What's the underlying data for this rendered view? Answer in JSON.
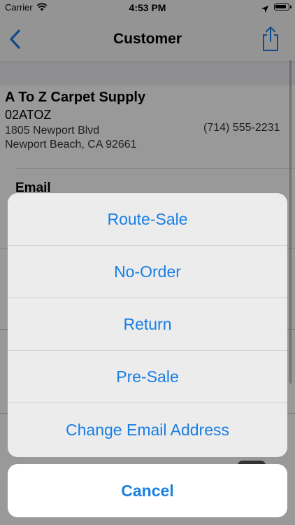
{
  "status_bar": {
    "carrier": "Carrier",
    "time": "4:53 PM"
  },
  "nav": {
    "title": "Customer"
  },
  "customer": {
    "name": "A To Z Carpet Supply",
    "code": "02ATOZ",
    "address_line1": "1805 Newport Blvd",
    "address_line2": "Newport Beach, CA  92661",
    "phone": "(714) 555-2231"
  },
  "section": {
    "email_label": "Email"
  },
  "action_sheet": {
    "actions": [
      {
        "label": "Route-Sale"
      },
      {
        "label": "No-Order"
      },
      {
        "label": "Return"
      },
      {
        "label": "Pre-Sale"
      },
      {
        "label": "Change Email Address"
      }
    ],
    "cancel_label": "Cancel"
  },
  "colors": {
    "accent": "#1a7fe4",
    "nav_background": "#f7f7f7",
    "overlay": "rgba(0,0,0,0.40)"
  },
  "icons": [
    "wifi-icon",
    "location-arrow-icon",
    "battery-icon",
    "back-chevron-icon",
    "share-icon"
  ]
}
